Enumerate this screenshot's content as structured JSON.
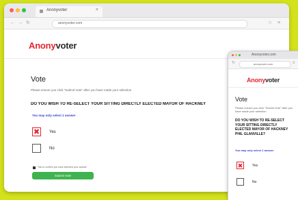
{
  "desktop": {
    "tab_title": "Anonyvoter",
    "url": "anonyvoter.com",
    "logo": {
      "part1": "Anony",
      "part2": "voter"
    },
    "vote_title": "Vote",
    "instructions": "Please ensure you click \"Submit Vote\" after you have made your selection",
    "question": "DO YOU WISH TO RE-SELECT YOUR SITTING DIRECTLY ELECTED MAYOR OF HACKNEY",
    "select_note": "You may only select 1 answer",
    "options": [
      {
        "label": "Yes",
        "checked": true
      },
      {
        "label": "No",
        "checked": false
      }
    ],
    "confirm_text": "Tick to confirm you have selected your answer",
    "submit_label": "Submit Vote"
  },
  "mobile": {
    "title": "Anonyvoter.com",
    "url": "anonyvoter.com",
    "logo": {
      "part1": "Anony",
      "part2": "voter"
    },
    "vote_title": "Vote",
    "instructions": "Please ensure you click \"Submit Vote\" after you have made your selection",
    "question": "DO YOU WISH TO RE-SELECT YOUR SITTING DIRECTLY ELECTED MAYOR OF HACKNEY PHIL GLANVILLE?",
    "select_note": "You may only select 1 answer",
    "options": [
      {
        "label": "Yes",
        "checked": true
      },
      {
        "label": "No",
        "checked": false
      }
    ]
  },
  "icons": {
    "check_mark": "✖",
    "back": "←",
    "forward": "→",
    "reload": "↻",
    "close": "×",
    "star": "☆",
    "menu": "≡"
  },
  "colors": {
    "background": "#d4e21c",
    "brand_red": "#e3262f",
    "submit_green": "#3fb34f",
    "link_blue": "#2b3fc2"
  }
}
